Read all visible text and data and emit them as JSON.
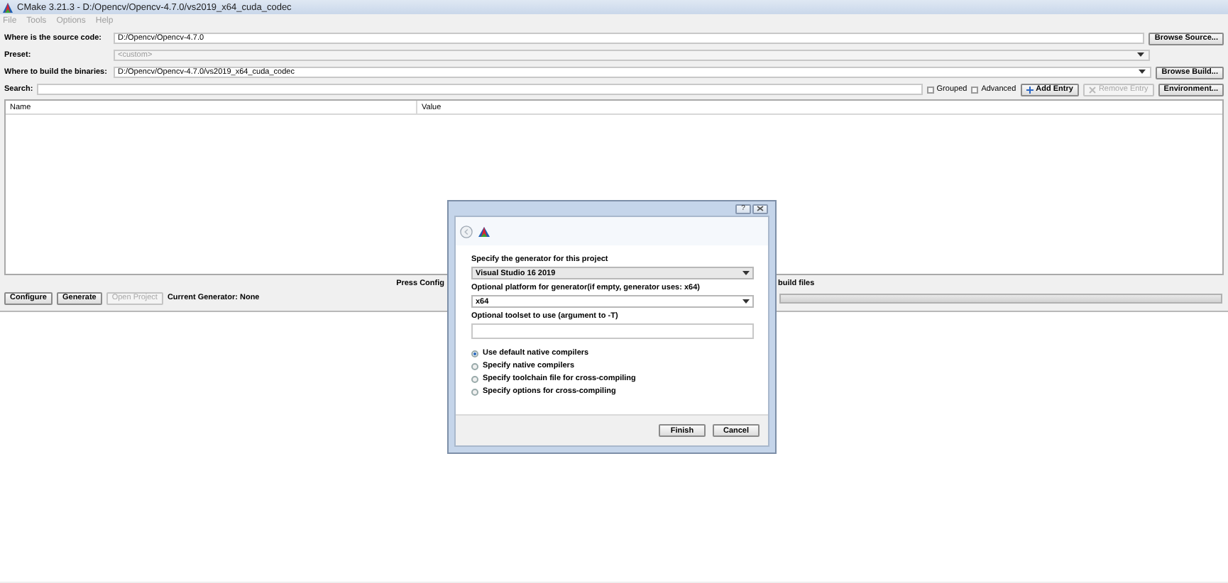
{
  "window": {
    "title": "CMake 3.21.3 - D:/Opencv/Opencv-4.7.0/vs2019_x64_cuda_codec"
  },
  "menu": [
    {
      "label": "File",
      "disabled": true
    },
    {
      "label": "Tools",
      "disabled": true
    },
    {
      "label": "Options",
      "disabled": true
    },
    {
      "label": "Help",
      "disabled": true
    }
  ],
  "source": {
    "label": "Where is the source code:",
    "value": "D:/Opencv/Opencv-4.7.0",
    "button": "Browse Source..."
  },
  "preset": {
    "label": "Preset:",
    "value": "<custom>",
    "disabled": true
  },
  "build": {
    "label": "Where to build the binaries:",
    "value": "D:/Opencv/Opencv-4.7.0/vs2019_x64_cuda_codec",
    "button": "Browse Build..."
  },
  "search": {
    "label": "Search:"
  },
  "options": [
    {
      "label": "Grouped",
      "checked": false
    },
    {
      "label": "Advanced",
      "checked": false
    }
  ],
  "entry_buttons": [
    {
      "kind": "add",
      "label": "Add Entry",
      "disabled": false
    },
    {
      "kind": "remove",
      "label": "Remove Entry",
      "disabled": true
    },
    {
      "kind": "plain",
      "label": "Environment...",
      "disabled": false
    }
  ],
  "table": {
    "columns": [
      "Name",
      "Value"
    ]
  },
  "status": {
    "left": "Press Config",
    "right": "build files"
  },
  "actions": [
    {
      "label": "Configure",
      "disabled": false
    },
    {
      "label": "Generate",
      "disabled": false
    },
    {
      "label": "Open Project",
      "disabled": true
    }
  ],
  "current_generator": "Current Generator: None",
  "progress": {
    "level": 0
  },
  "dialog": {
    "help_button": "?",
    "generator_label": "Specify the generator for this project",
    "generator": "Visual Studio 16 2019",
    "platform_label": "Optional platform for generator(if empty, generator uses: x64)",
    "platform": "x64",
    "toolset_label": "Optional toolset to use (argument to -T)",
    "compilers": [
      {
        "label": "Use default native compilers",
        "selected": true
      },
      {
        "label": "Specify native compilers",
        "selected": false
      },
      {
        "label": "Specify toolchain file for cross-compiling",
        "selected": false
      },
      {
        "label": "Specify options for cross-compiling",
        "selected": false
      }
    ],
    "buttons": [
      "Finish",
      "Cancel"
    ]
  }
}
